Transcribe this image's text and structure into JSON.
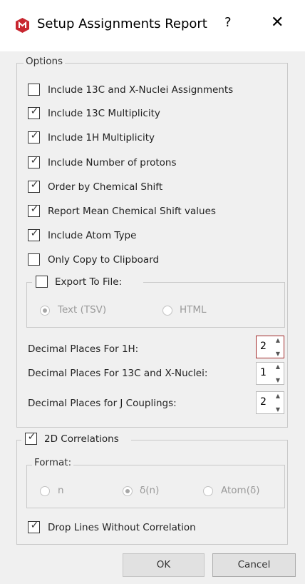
{
  "window": {
    "title": "Setup Assignments Report",
    "help_glyph": "?",
    "close_glyph": "✕",
    "icon": "mnova-app-icon",
    "accent_color": "#c8262f"
  },
  "options": {
    "legend": "Options",
    "checkboxes": [
      {
        "label": "Include 13C and X-Nuclei Assignments",
        "checked": false
      },
      {
        "label": "Include 13C Multiplicity",
        "checked": true
      },
      {
        "label": "Include 1H Multiplicity",
        "checked": true
      },
      {
        "label": "Include Number of protons",
        "checked": true
      },
      {
        "label": "Order by Chemical Shift",
        "checked": true
      },
      {
        "label": "Report Mean Chemical Shift values",
        "checked": true
      },
      {
        "label": "Include Atom Type",
        "checked": true
      },
      {
        "label": "Only Copy to Clipboard",
        "checked": false
      }
    ],
    "export": {
      "label": "Export To File:",
      "checked": false,
      "formats": [
        {
          "label": "Text (TSV)",
          "selected": true
        },
        {
          "label": "HTML",
          "selected": false
        }
      ]
    },
    "spinners": [
      {
        "label": "Decimal Places For 1H:",
        "value": "2",
        "focused": true
      },
      {
        "label": "Decimal Places For 13C and X-Nuclei:",
        "value": "1",
        "focused": false
      },
      {
        "label": "Decimal Places for J Couplings:",
        "value": "2",
        "focused": false
      }
    ]
  },
  "correlations": {
    "label": "2D Correlations",
    "checked": true,
    "format": {
      "legend": "Format:",
      "options": [
        {
          "label": "n",
          "selected": false
        },
        {
          "label": "δ(n)",
          "selected": true
        },
        {
          "label": "Atom(δ)",
          "selected": false
        }
      ]
    },
    "drop_lines": {
      "label": "Drop Lines Without Correlation",
      "checked": true
    }
  },
  "buttons": {
    "ok": "OK",
    "cancel": "Cancel"
  }
}
